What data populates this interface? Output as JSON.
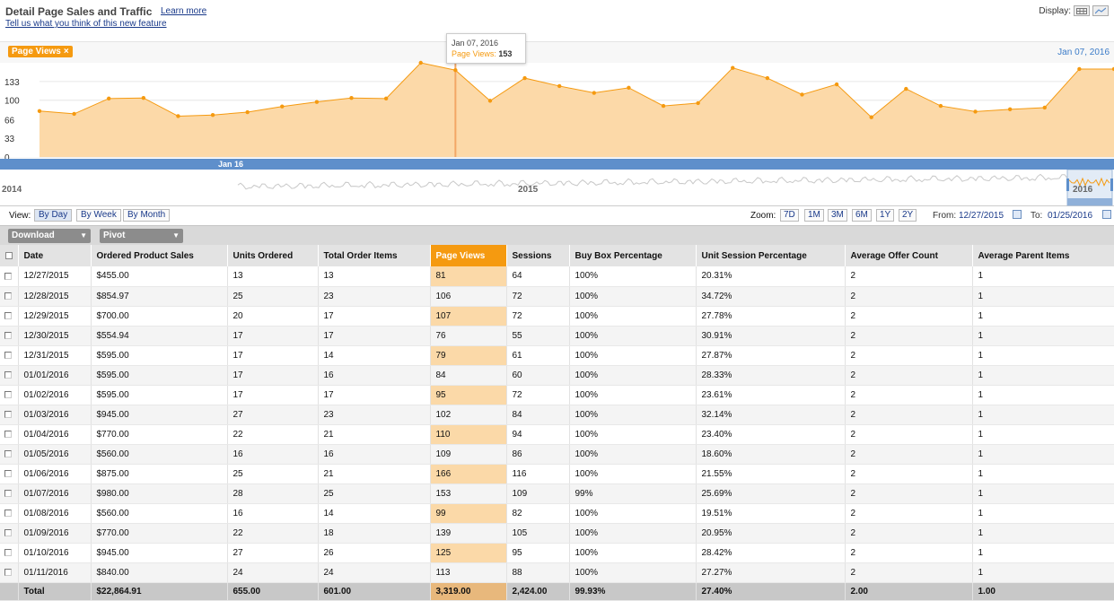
{
  "header": {
    "title": "Detail Page Sales and Traffic",
    "learn_more": "Learn more",
    "feedback": "Tell us what you think of this new feature",
    "display_label": "Display:"
  },
  "chart": {
    "series_chip": "Page Views",
    "chip_close": "×",
    "current_date": "Jan 07, 2016",
    "tooltip_date": "Jan 07, 2016",
    "tooltip_series": "Page Views:",
    "tooltip_value": "153",
    "nav_label": "Jan 16",
    "overview_labels": [
      "2014",
      "2015",
      "2016"
    ],
    "colors": {
      "line": "#f59a10",
      "fill": "#fcd9a8",
      "navbar": "#5e8fcb"
    }
  },
  "chart_data": {
    "type": "area",
    "series": [
      {
        "name": "Page Views",
        "values": [
          81,
          76,
          103,
          104,
          72,
          74,
          79,
          89,
          97,
          104,
          103,
          166,
          153,
          99,
          139,
          125,
          113,
          122,
          90,
          95,
          157,
          139,
          110,
          128,
          70,
          120,
          90,
          80,
          84,
          87,
          155,
          155
        ]
      }
    ],
    "yticks": [
      "0",
      "33",
      "66",
      "100",
      "133"
    ],
    "ylim": [
      0,
      166
    ],
    "highlight_index": 12,
    "grid": true
  },
  "controls": {
    "view_label": "View:",
    "view_buttons": [
      "By Day",
      "By Week",
      "By Month"
    ],
    "zoom_label": "Zoom:",
    "zoom_buttons": [
      "7D",
      "1M",
      "3M",
      "6M",
      "1Y",
      "2Y"
    ],
    "from_label": "From:",
    "from_value": "12/27/2015",
    "to_label": "To:",
    "to_value": "01/25/2016"
  },
  "toolbar": {
    "download": "Download",
    "pivot": "Pivot"
  },
  "table": {
    "columns": [
      "Date",
      "Ordered Product Sales",
      "Units Ordered",
      "Total Order Items",
      "Page Views",
      "Sessions",
      "Buy Box Percentage",
      "Unit Session Percentage",
      "Average Offer Count",
      "Average Parent Items"
    ],
    "rows": [
      [
        "12/27/2015",
        "$455.00",
        "13",
        "13",
        "81",
        "64",
        "100%",
        "20.31%",
        "2",
        "1"
      ],
      [
        "12/28/2015",
        "$854.97",
        "25",
        "23",
        "106",
        "72",
        "100%",
        "34.72%",
        "2",
        "1"
      ],
      [
        "12/29/2015",
        "$700.00",
        "20",
        "17",
        "107",
        "72",
        "100%",
        "27.78%",
        "2",
        "1"
      ],
      [
        "12/30/2015",
        "$554.94",
        "17",
        "17",
        "76",
        "55",
        "100%",
        "30.91%",
        "2",
        "1"
      ],
      [
        "12/31/2015",
        "$595.00",
        "17",
        "14",
        "79",
        "61",
        "100%",
        "27.87%",
        "2",
        "1"
      ],
      [
        "01/01/2016",
        "$595.00",
        "17",
        "16",
        "84",
        "60",
        "100%",
        "28.33%",
        "2",
        "1"
      ],
      [
        "01/02/2016",
        "$595.00",
        "17",
        "17",
        "95",
        "72",
        "100%",
        "23.61%",
        "2",
        "1"
      ],
      [
        "01/03/2016",
        "$945.00",
        "27",
        "23",
        "102",
        "84",
        "100%",
        "32.14%",
        "2",
        "1"
      ],
      [
        "01/04/2016",
        "$770.00",
        "22",
        "21",
        "110",
        "94",
        "100%",
        "23.40%",
        "2",
        "1"
      ],
      [
        "01/05/2016",
        "$560.00",
        "16",
        "16",
        "109",
        "86",
        "100%",
        "18.60%",
        "2",
        "1"
      ],
      [
        "01/06/2016",
        "$875.00",
        "25",
        "21",
        "166",
        "116",
        "100%",
        "21.55%",
        "2",
        "1"
      ],
      [
        "01/07/2016",
        "$980.00",
        "28",
        "25",
        "153",
        "109",
        "99%",
        "25.69%",
        "2",
        "1"
      ],
      [
        "01/08/2016",
        "$560.00",
        "16",
        "14",
        "99",
        "82",
        "100%",
        "19.51%",
        "2",
        "1"
      ],
      [
        "01/09/2016",
        "$770.00",
        "22",
        "18",
        "139",
        "105",
        "100%",
        "20.95%",
        "2",
        "1"
      ],
      [
        "01/10/2016",
        "$945.00",
        "27",
        "26",
        "125",
        "95",
        "100%",
        "28.42%",
        "2",
        "1"
      ],
      [
        "01/11/2016",
        "$840.00",
        "24",
        "24",
        "113",
        "88",
        "100%",
        "27.27%",
        "2",
        "1"
      ]
    ],
    "total": [
      "Total",
      "$22,864.91",
      "655.00",
      "601.00",
      "3,319.00",
      "2,424.00",
      "99.93%",
      "27.40%",
      "2.00",
      "1.00"
    ]
  }
}
